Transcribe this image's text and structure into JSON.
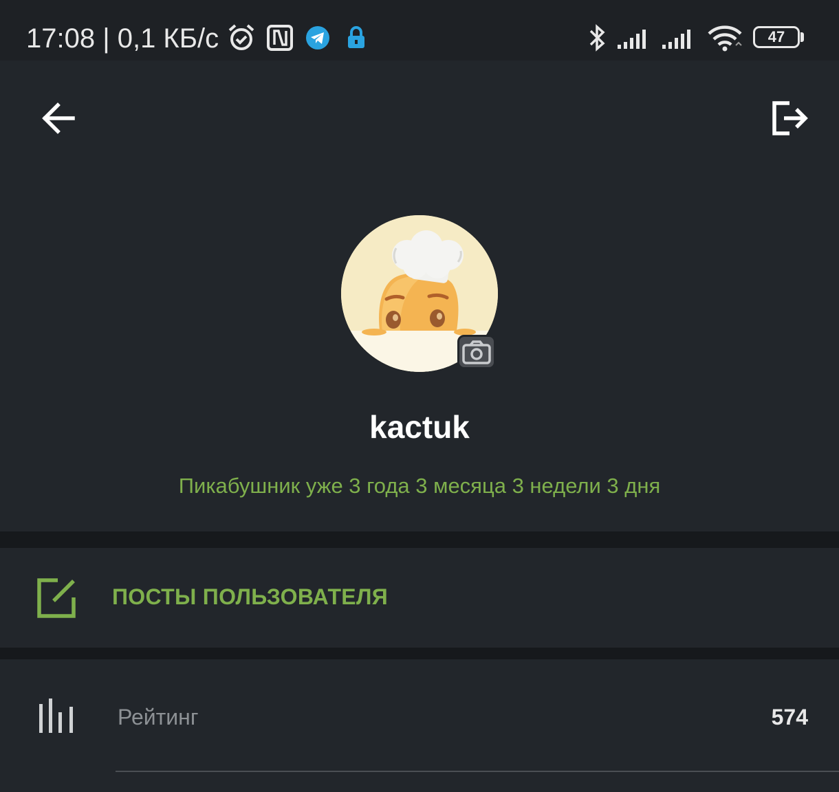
{
  "status_bar": {
    "time_speed": "17:08 | 0,1 КБ/с",
    "battery_level": "47"
  },
  "profile": {
    "username": "kactuk",
    "membership": "Пикабушник уже 3 года 3 месяца 3 недели 3 дня"
  },
  "menu": {
    "posts_label": "ПОСТЫ ПОЛЬЗОВАТЕЛЯ"
  },
  "stats": {
    "rating_label": "Рейтинг",
    "rating_value": "574"
  },
  "colors": {
    "background": "#22262b",
    "accent_green": "#7fb04c",
    "divider": "#16191c",
    "muted_text": "#8d9195"
  }
}
